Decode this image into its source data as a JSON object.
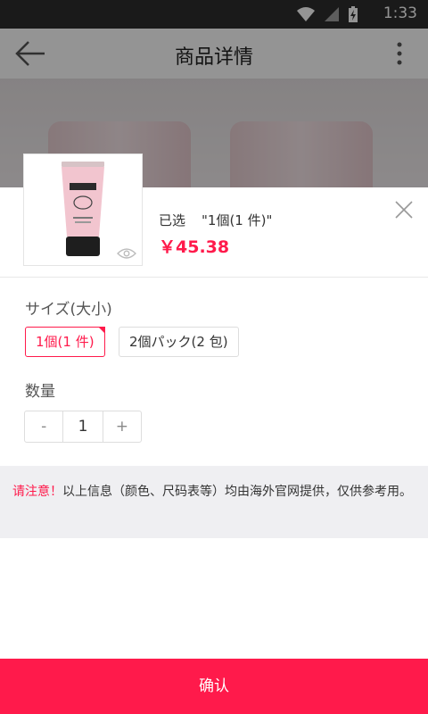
{
  "status_bar": {
    "time": "1:33"
  },
  "header": {
    "title": "商品详情"
  },
  "sheet": {
    "selected_label": "已选",
    "selected_value": "\"1個(1 件)\"",
    "price": "￥45.38",
    "size_label": "サイズ(大小)",
    "size_options": [
      {
        "label": "1個(1 件)",
        "selected": true
      },
      {
        "label": "2個パック(2 包)",
        "selected": false
      }
    ],
    "quantity_label": "数量",
    "quantity": {
      "minus": "-",
      "value": "1",
      "plus": "+"
    },
    "notice": {
      "warn": "请注意！",
      "text": "以上信息（颜色、尺码表等）均由海外官网提供，仅供参考用。"
    },
    "confirm_label": "确认"
  },
  "colors": {
    "accent": "#ff1a4b",
    "status_bar": "#2e2e2e",
    "notice_bg": "#efeff2"
  },
  "icons": [
    "back-arrow-icon",
    "more-vertical-icon",
    "close-icon",
    "eye-icon",
    "wifi-icon",
    "signal-icon",
    "battery-charging-icon"
  ]
}
